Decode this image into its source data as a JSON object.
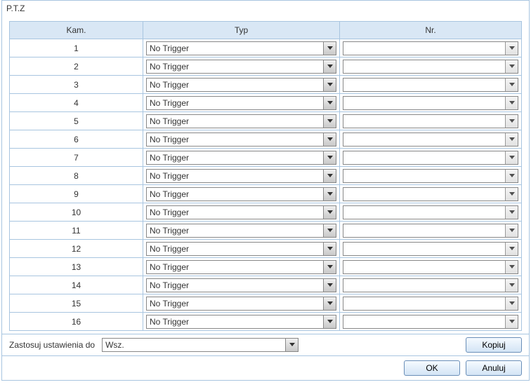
{
  "panel": {
    "title": "P.T.Z"
  },
  "columns": {
    "kam": "Kam.",
    "typ": "Typ",
    "nr": "Nr."
  },
  "rows": [
    {
      "kam": "1",
      "typ": "No Trigger",
      "nr": ""
    },
    {
      "kam": "2",
      "typ": "No Trigger",
      "nr": ""
    },
    {
      "kam": "3",
      "typ": "No Trigger",
      "nr": ""
    },
    {
      "kam": "4",
      "typ": "No Trigger",
      "nr": ""
    },
    {
      "kam": "5",
      "typ": "No Trigger",
      "nr": ""
    },
    {
      "kam": "6",
      "typ": "No Trigger",
      "nr": ""
    },
    {
      "kam": "7",
      "typ": "No Trigger",
      "nr": ""
    },
    {
      "kam": "8",
      "typ": "No Trigger",
      "nr": ""
    },
    {
      "kam": "9",
      "typ": "No Trigger",
      "nr": ""
    },
    {
      "kam": "10",
      "typ": "No Trigger",
      "nr": ""
    },
    {
      "kam": "11",
      "typ": "No Trigger",
      "nr": ""
    },
    {
      "kam": "12",
      "typ": "No Trigger",
      "nr": ""
    },
    {
      "kam": "13",
      "typ": "No Trigger",
      "nr": ""
    },
    {
      "kam": "14",
      "typ": "No Trigger",
      "nr": ""
    },
    {
      "kam": "15",
      "typ": "No Trigger",
      "nr": ""
    },
    {
      "kam": "16",
      "typ": "No Trigger",
      "nr": ""
    }
  ],
  "apply": {
    "label": "Zastosuj ustawienia do",
    "value": "Wsz."
  },
  "buttons": {
    "copy": "Kopiuj",
    "ok": "OK",
    "cancel": "Anuluj"
  }
}
